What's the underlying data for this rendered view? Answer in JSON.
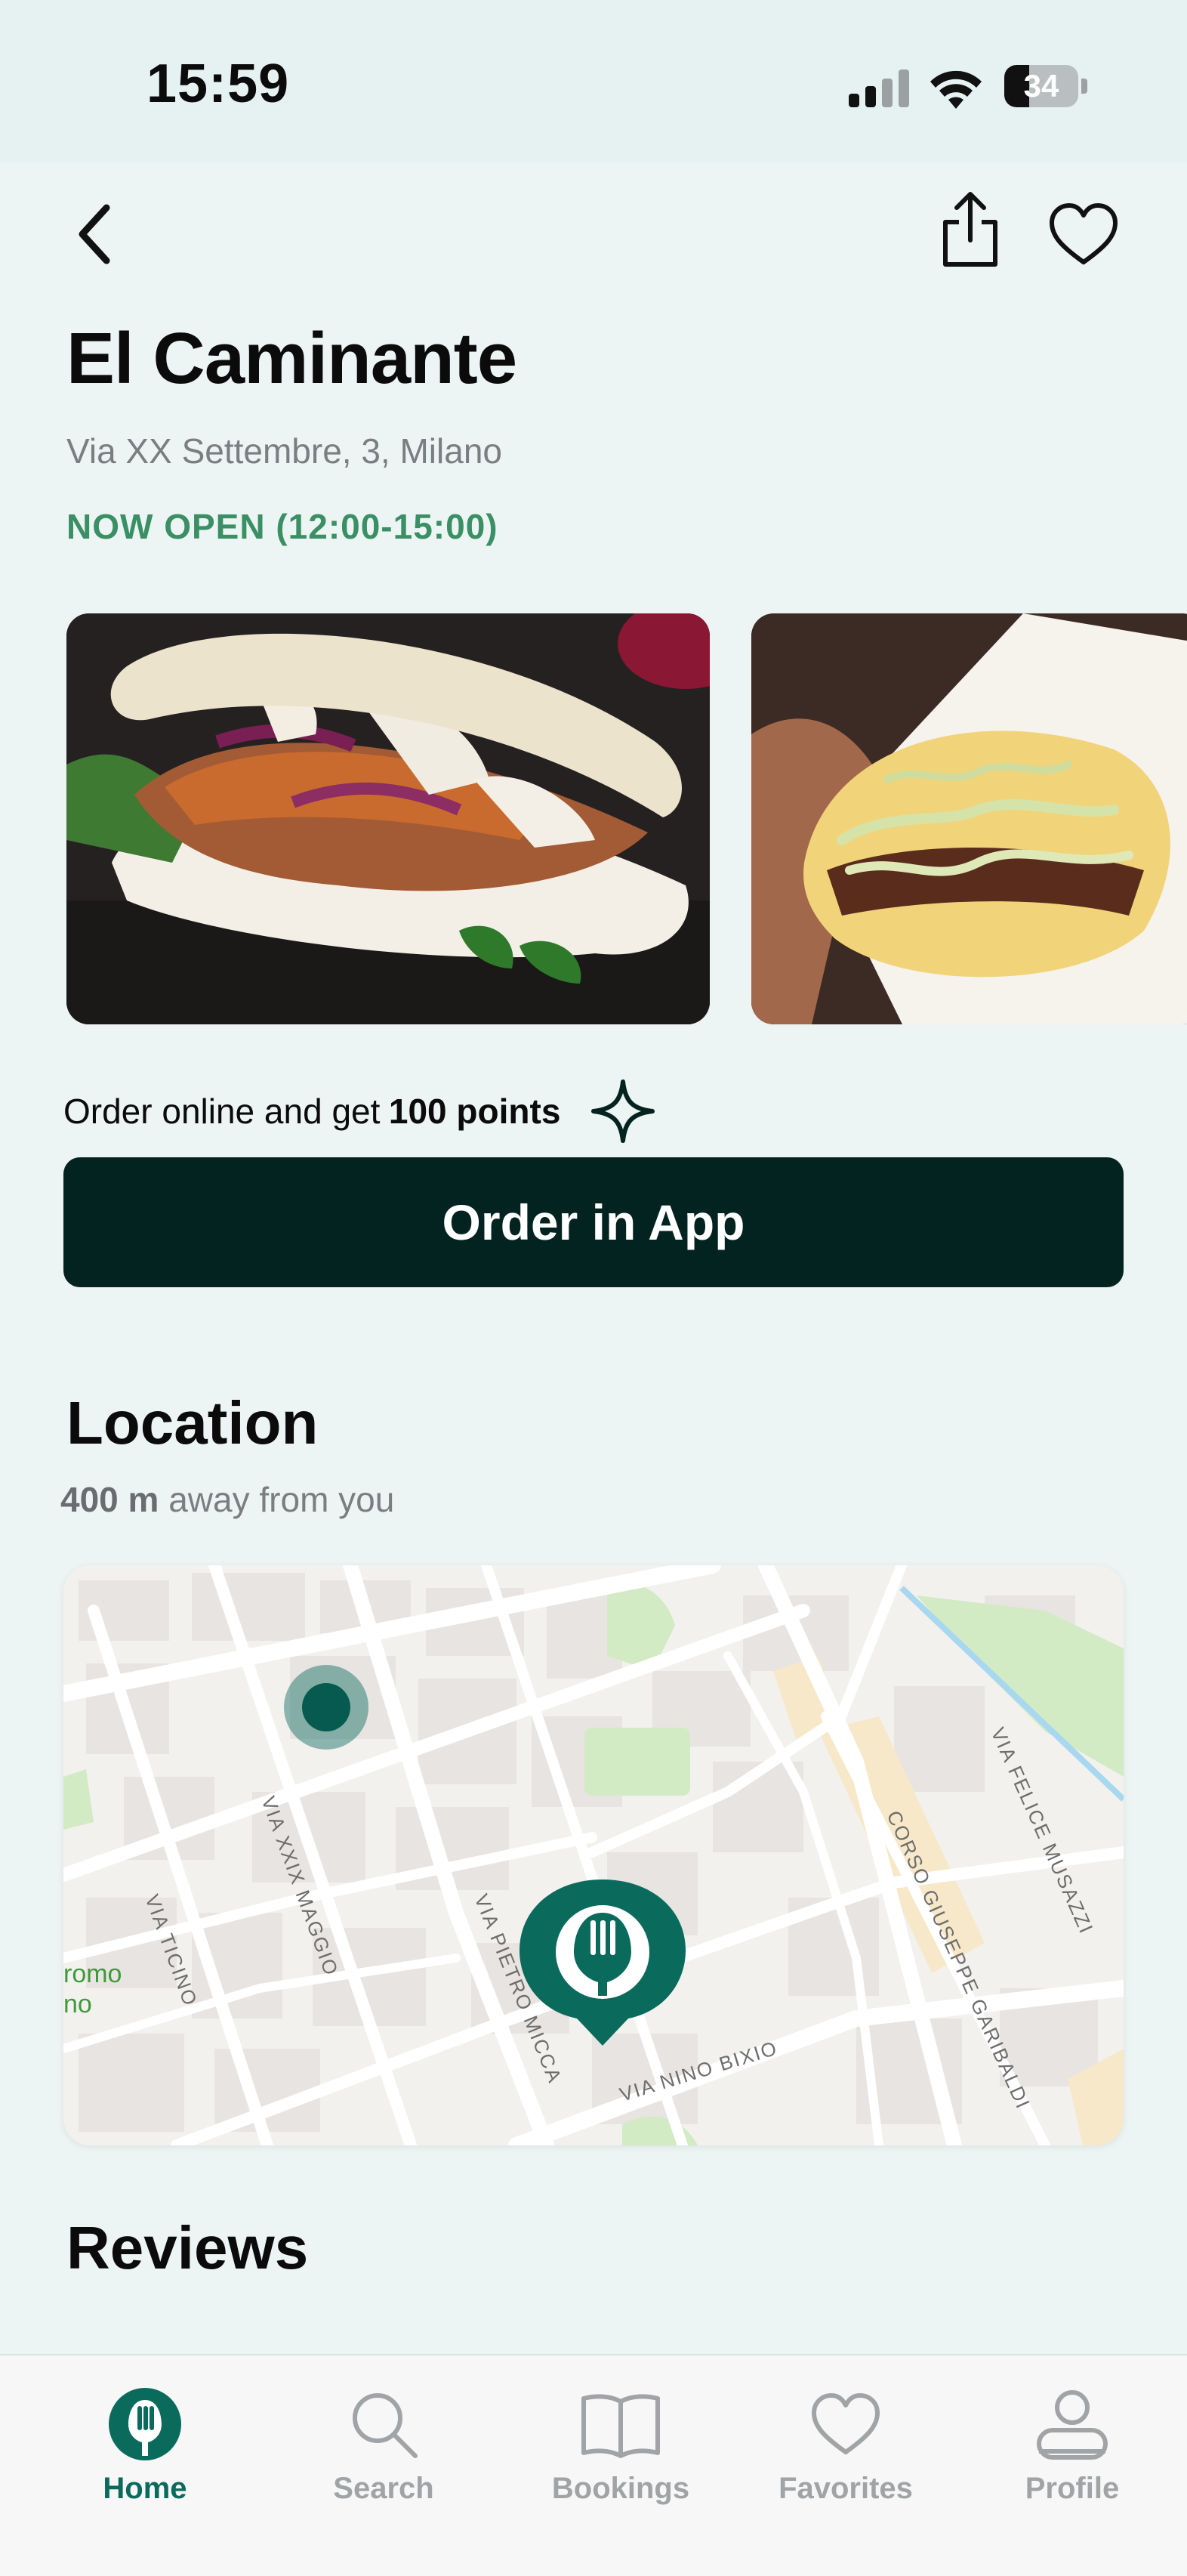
{
  "status_bar": {
    "time": "15:59",
    "battery": "34"
  },
  "restaurant": {
    "name": "El Caminante",
    "address": "Via XX Settembre, 3, Milano",
    "open_status": "NOW OPEN (12:00-15:00)"
  },
  "promo": {
    "prefix": "Order online and get",
    "points": "100 points"
  },
  "order_button": "Order in App",
  "location": {
    "title": "Location",
    "distance_value": "400 m",
    "distance_suffix": "away from you",
    "map_labels": {
      "via_xxix_maggio": "VIA XXIX MAGGIO",
      "via_ticino": "VIA TICINO",
      "via_pietro_micca": "VIA PIETRO MICCA",
      "via_nino_bixio": "VIA NINO BIXIO",
      "corso_garibaldi": "CORSO GIUSEPPE GARIBALDI",
      "via_felice_musazzi": "VIA FELICE MUSAZZI",
      "park_label_1": "romo",
      "park_label_2": "no"
    }
  },
  "reviews": {
    "title": "Reviews"
  },
  "tabs": [
    {
      "label": "Home",
      "icon": "fork-logo-icon",
      "active": true
    },
    {
      "label": "Search",
      "icon": "search-icon"
    },
    {
      "label": "Bookings",
      "icon": "book-icon"
    },
    {
      "label": "Favorites",
      "icon": "heart-icon"
    },
    {
      "label": "Profile",
      "icon": "profile-icon"
    }
  ],
  "colors": {
    "accent": "#0a6b5d",
    "open_green": "#3a8f64",
    "button_dark": "#032320",
    "background": "#edf5f4"
  }
}
